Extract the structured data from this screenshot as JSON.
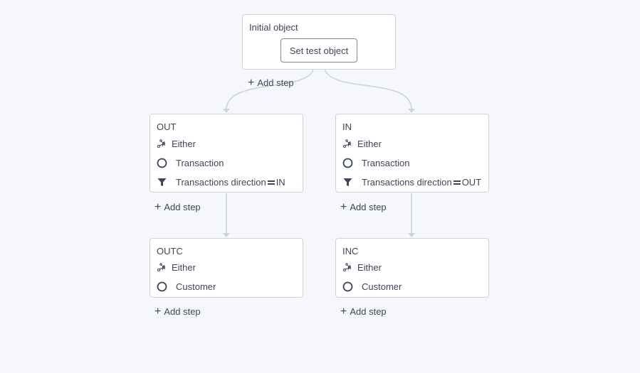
{
  "root": {
    "title": "Initial object",
    "button_label": "Set test object",
    "add_step_label": "Add step"
  },
  "branches": [
    {
      "step": {
        "title": "OUT",
        "relation": "Either",
        "object": "Transaction",
        "filter_field": "Transactions direction",
        "filter_value": "IN",
        "add_step_label": "Add step"
      },
      "child": {
        "title": "OUTC",
        "relation": "Either",
        "object": "Customer",
        "add_step_label": "Add step"
      }
    },
    {
      "step": {
        "title": "IN",
        "relation": "Either",
        "object": "Transaction",
        "filter_field": "Transactions direction",
        "filter_value": "OUT",
        "add_step_label": "Add step"
      },
      "child": {
        "title": "INC",
        "relation": "Either",
        "object": "Customer",
        "add_step_label": "Add step"
      }
    }
  ],
  "icons": {
    "relation": "graph-link-icon",
    "object": "circle-icon",
    "filter": "funnel-icon",
    "add": "plus-icon"
  },
  "colors": {
    "background": "#f5f7fa",
    "connector": "#ccd3de",
    "text": "#3d4758"
  }
}
